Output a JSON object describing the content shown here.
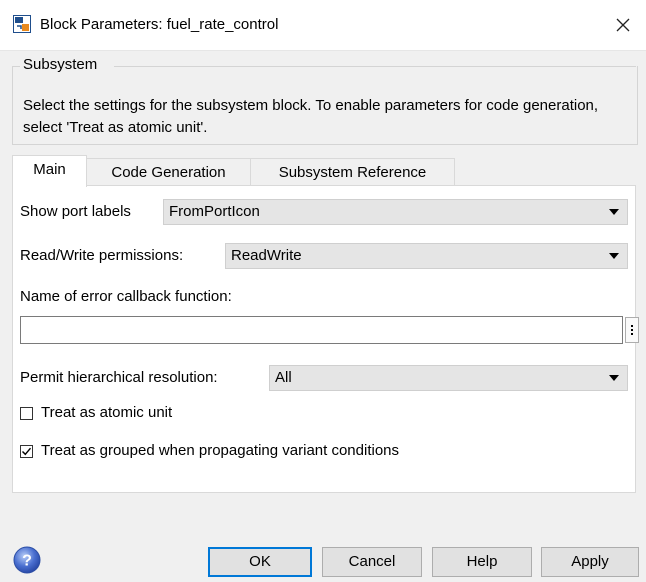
{
  "window": {
    "title": "Block Parameters: fuel_rate_control"
  },
  "group": {
    "label": "Subsystem",
    "description": "Select the settings for the subsystem block. To enable parameters for code generation, select 'Treat as atomic unit'."
  },
  "tabs": [
    {
      "label": "Main",
      "active": true
    },
    {
      "label": "Code Generation",
      "active": false
    },
    {
      "label": "Subsystem Reference",
      "active": false
    }
  ],
  "main": {
    "show_port_labels": {
      "label": "Show port labels",
      "value": "FromPortIcon"
    },
    "read_write": {
      "label": "Read/Write permissions:",
      "value": "ReadWrite"
    },
    "error_callback": {
      "label": "Name of error callback function:",
      "value": ""
    },
    "hierarchical": {
      "label": "Permit hierarchical resolution:",
      "value": "All"
    },
    "atomic": {
      "label": "Treat as atomic unit",
      "checked": false
    },
    "grouped": {
      "label": "Treat as grouped when propagating variant conditions",
      "checked": true
    }
  },
  "buttons": {
    "ok": "OK",
    "cancel": "Cancel",
    "help": "Help",
    "apply": "Apply"
  },
  "icons": {
    "app": "simulink-block-icon",
    "help": "help-icon",
    "close": "close-icon"
  },
  "colors": {
    "accent": "#0078d7",
    "panel_bg": "#ffffff",
    "window_bg": "#f0f0f0"
  }
}
